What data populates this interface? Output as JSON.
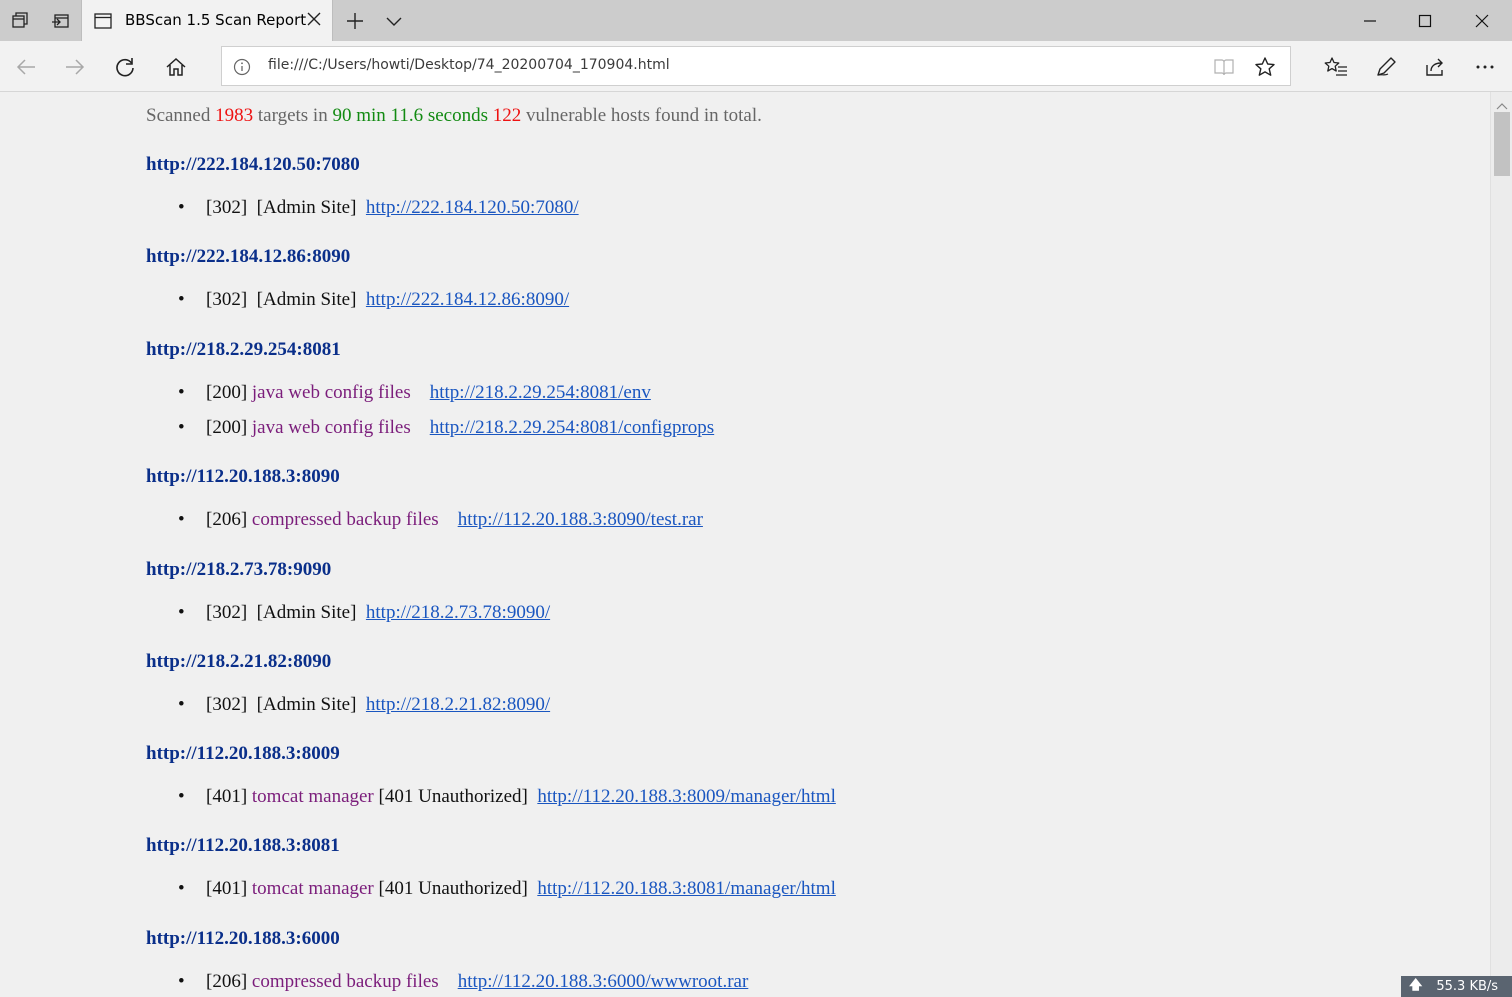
{
  "browser": {
    "tab_title": "BBScan 1.5 Scan Report",
    "url": "file:///C:/Users/howti/Desktop/74_20200704_170904.html"
  },
  "summary": {
    "scanned_word": "Scanned",
    "targets_count": "1983",
    "targets_in": "targets in",
    "minutes": "90 min",
    "seconds": "11.6 seconds",
    "vuln_count": "122",
    "tail": "vulnerable hosts found in total."
  },
  "hosts": [
    {
      "host": "http://222.184.120.50:7080",
      "items": [
        {
          "status": "[302]",
          "type": "[Admin Site]",
          "extra": "",
          "link": "http://222.184.120.50:7080/"
        }
      ]
    },
    {
      "host": "http://222.184.12.86:8090",
      "items": [
        {
          "status": "[302]",
          "type": "[Admin Site]",
          "extra": "",
          "link": "http://222.184.12.86:8090/"
        }
      ]
    },
    {
      "host": "http://218.2.29.254:8081",
      "items": [
        {
          "status": "[200]",
          "vuln": "java web config files",
          "extra": "",
          "link": "http://218.2.29.254:8081/env"
        },
        {
          "status": "[200]",
          "vuln": "java web config files",
          "extra": "",
          "link": "http://218.2.29.254:8081/configprops"
        }
      ]
    },
    {
      "host": "http://112.20.188.3:8090",
      "items": [
        {
          "status": "[206]",
          "vuln": "compressed backup files",
          "extra": "",
          "link": "http://112.20.188.3:8090/test.rar"
        }
      ]
    },
    {
      "host": "http://218.2.73.78:9090",
      "items": [
        {
          "status": "[302]",
          "type": "[Admin Site]",
          "extra": "",
          "link": "http://218.2.73.78:9090/"
        }
      ]
    },
    {
      "host": "http://218.2.21.82:8090",
      "items": [
        {
          "status": "[302]",
          "type": "[Admin Site]",
          "extra": "",
          "link": "http://218.2.21.82:8090/"
        }
      ]
    },
    {
      "host": "http://112.20.188.3:8009",
      "items": [
        {
          "status": "[401]",
          "vuln": "tomcat manager",
          "extra": "[401 Unauthorized]",
          "link": "http://112.20.188.3:8009/manager/html"
        }
      ]
    },
    {
      "host": "http://112.20.188.3:8081",
      "items": [
        {
          "status": "[401]",
          "vuln": "tomcat manager",
          "extra": "[401 Unauthorized]",
          "link": "http://112.20.188.3:8081/manager/html"
        }
      ]
    },
    {
      "host": "http://112.20.188.3:6000",
      "items": [
        {
          "status": "[206]",
          "vuln": "compressed backup files",
          "extra": "",
          "link": "http://112.20.188.3:6000/wwwroot.rar"
        }
      ]
    }
  ],
  "status_badge": {
    "speed": "55.3 KB/s"
  },
  "colors": {
    "host": "#0a2f8a",
    "link": "#1a56c0",
    "vuln": "#7b1d7b",
    "count_red": "#e11111",
    "time_green": "#128a12"
  },
  "icons": [
    "tabs-aside-icon",
    "restore-tabs-icon",
    "page-icon",
    "close-icon",
    "new-tab-icon",
    "chevron-down-icon",
    "minimize-icon",
    "maximize-icon",
    "window-close-icon",
    "back-icon",
    "forward-icon",
    "refresh-icon",
    "home-icon",
    "info-icon",
    "reading-view-icon",
    "favorite-star-icon",
    "favorites-hub-icon",
    "pen-icon",
    "share-icon",
    "more-icon"
  ]
}
